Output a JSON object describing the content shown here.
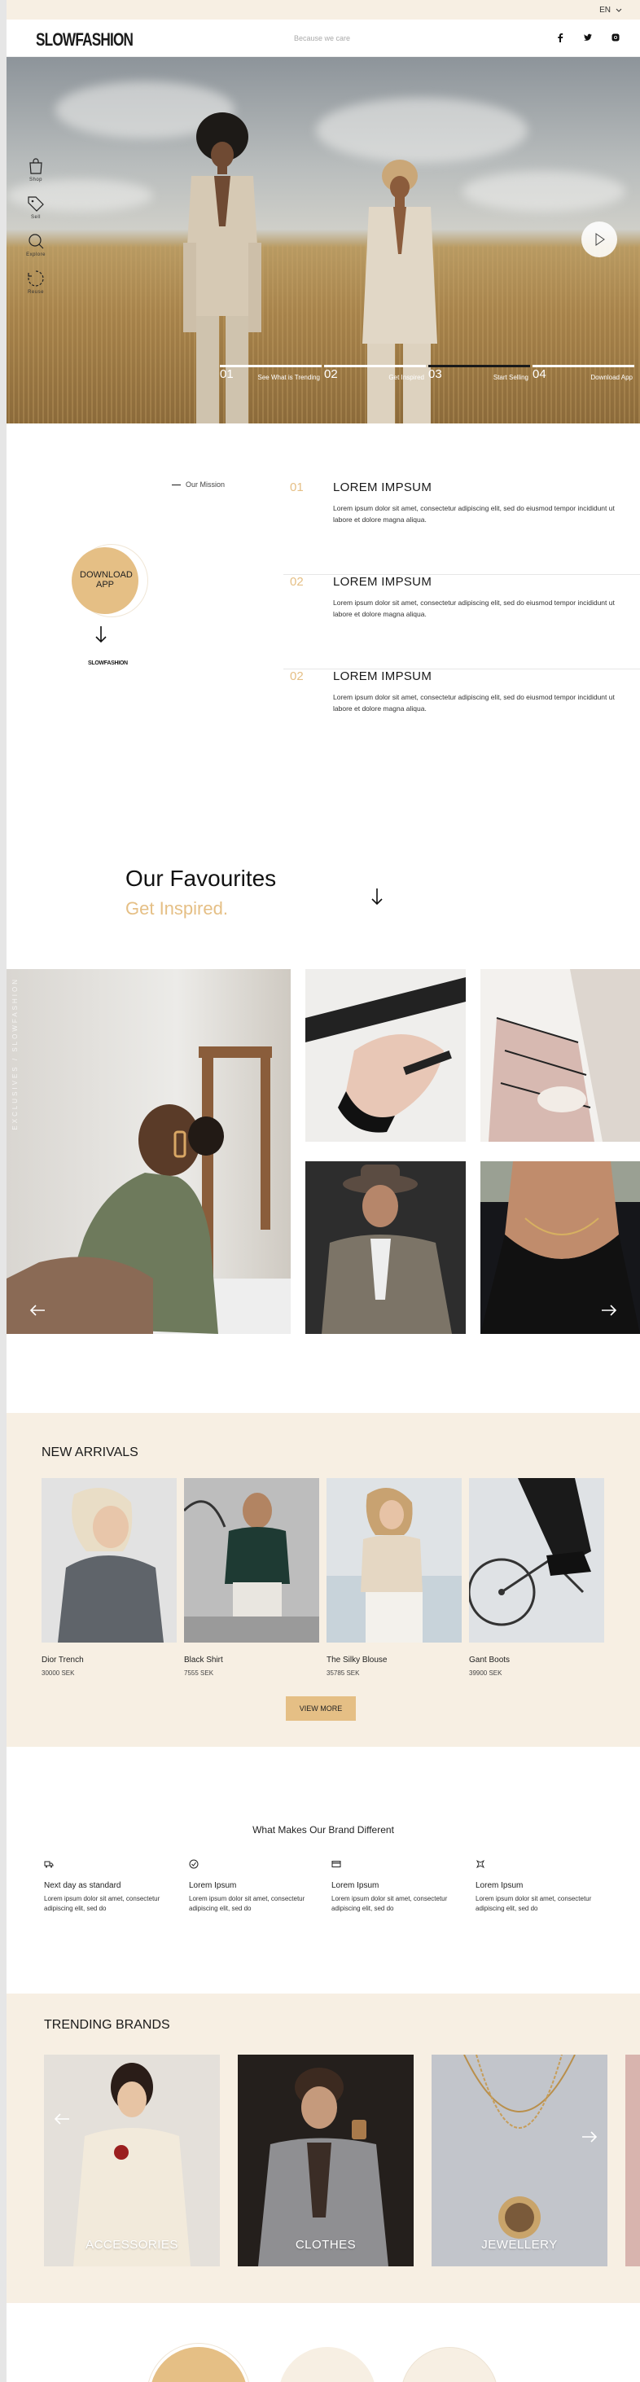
{
  "topbar": {
    "language": "EN"
  },
  "header": {
    "logo": "SLOWFASHION",
    "tagline": "Because we care"
  },
  "hero": {
    "side_nav": [
      {
        "label": "Shop",
        "icon": "bag-icon"
      },
      {
        "label": "Sell",
        "icon": "tag-icon"
      },
      {
        "label": "Explore",
        "icon": "search-icon"
      },
      {
        "label": "Reuse",
        "icon": "recycle-icon"
      }
    ],
    "steps": [
      {
        "num": "01",
        "label": "See What is Trending"
      },
      {
        "num": "02",
        "label": "Get Inspired"
      },
      {
        "num": "03",
        "label": "Start Selling"
      },
      {
        "num": "04",
        "label": "Download App"
      }
    ]
  },
  "mission": {
    "label": "Our Mission",
    "download": "DOWNLOAD APP",
    "brand_small": "SLOWFASHION",
    "items": [
      {
        "num": "01",
        "title": "LOREM IMPSUM",
        "text": "Lorem ipsum dolor sit amet, consectetur adipiscing elit, sed do eiusmod tempor incididunt ut labore et dolore magna aliqua."
      },
      {
        "num": "02",
        "title": "LOREM IMPSUM",
        "text": "Lorem ipsum dolor sit amet, consectetur adipiscing elit, sed do eiusmod tempor incididunt ut labore et dolore magna aliqua."
      },
      {
        "num": "02",
        "title": "LOREM IMPSUM",
        "text": "Lorem ipsum dolor sit amet, consectetur adipiscing elit, sed do eiusmod tempor incididunt ut labore et dolore magna aliqua."
      }
    ]
  },
  "favourites": {
    "title": "Our Favourites",
    "subtitle": "Get Inspired.",
    "vertical_text": "EXCLUSIVES / SLOWFASHION"
  },
  "arrivals": {
    "title": "NEW ARRIVALS",
    "products": [
      {
        "name": "Dior Trench",
        "price": "30000 SEK"
      },
      {
        "name": "Black Shirt",
        "price": "7555 SEK"
      },
      {
        "name": "The Silky Blouse",
        "price": "35785 SEK"
      },
      {
        "name": "Gant Boots",
        "price": "39900 SEK"
      }
    ],
    "view_more": "VIEW MORE"
  },
  "different": {
    "title": "What Makes Our Brand Different",
    "features": [
      {
        "icon": "truck-icon",
        "title": "Next day as standard",
        "text": "Lorem ipsum dolor sit amet, consectetur adipiscing elit, sed do"
      },
      {
        "icon": "check-circle-icon",
        "title": "Lorem Ipsum",
        "text": "Lorem ipsum dolor sit amet, consectetur adipiscing elit, sed do"
      },
      {
        "icon": "card-icon",
        "title": "Lorem Ipsum",
        "text": "Lorem ipsum dolor sit amet, consectetur adipiscing elit, sed do"
      },
      {
        "icon": "sparkle-icon",
        "title": "Lorem Ipsum",
        "text": "Lorem ipsum dolor sit amet, consectetur adipiscing elit, sed do"
      }
    ]
  },
  "trending": {
    "title": "TRENDING BRANDS",
    "cards": [
      {
        "caption": "ACCESSORIES"
      },
      {
        "caption": "CLOTHES"
      },
      {
        "caption": "JEWELLERY"
      }
    ]
  },
  "colors": {
    "accent": "#e5bf85",
    "cream": "#f7efe3",
    "text": "#1a1a1a"
  }
}
